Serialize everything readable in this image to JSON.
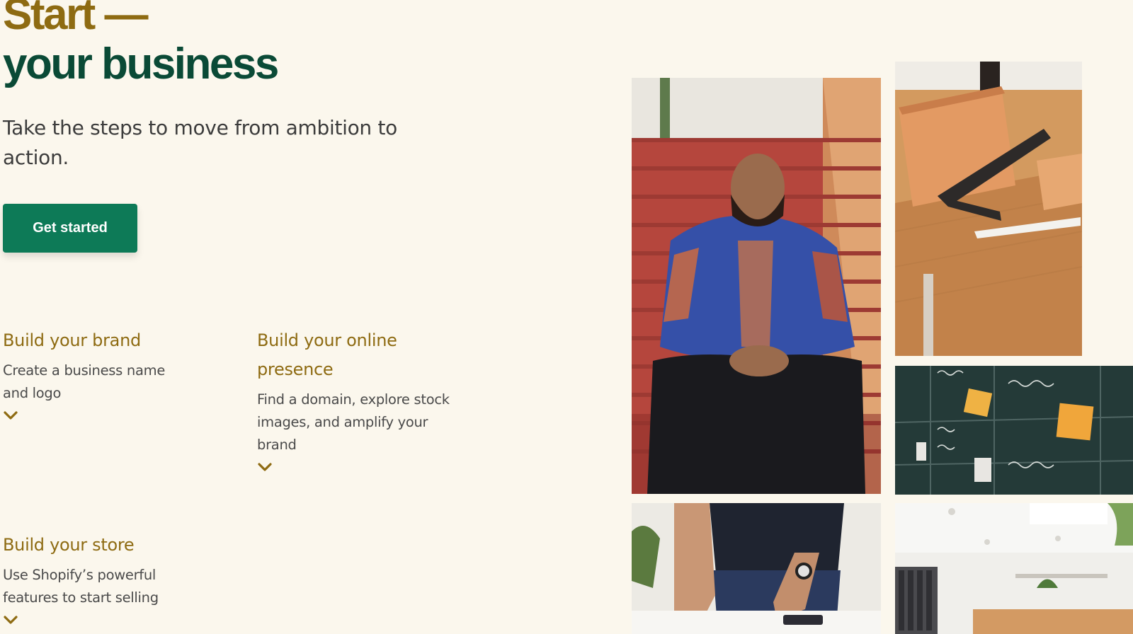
{
  "hero": {
    "title_line1": "Start —",
    "title_line2": "your business",
    "subtitle": "Take the steps to move from ambition to action.",
    "cta_label": "Get started"
  },
  "features": [
    {
      "title": "Build your brand",
      "description": "Create a business name and logo"
    },
    {
      "title": "Build your online presence",
      "description": "Find a domain, explore stock images, and amplify your brand"
    },
    {
      "title": "Build your store",
      "description": "Use Shopify’s powerful features to start selling"
    }
  ],
  "photos": [
    {
      "name": "photo-man-on-stairs"
    },
    {
      "name": "photo-desk-notebook-ruler"
    },
    {
      "name": "photo-social-board"
    },
    {
      "name": "photo-hands-phone"
    },
    {
      "name": "photo-clothing-store"
    }
  ],
  "colors": {
    "background": "#fbf7ed",
    "accent_gold": "#8e6b12",
    "accent_green": "#0a4a36",
    "button_green": "#0d7a57",
    "body_text": "#3c3c3c"
  },
  "icons": {
    "chevron": "chevron-down-icon"
  }
}
